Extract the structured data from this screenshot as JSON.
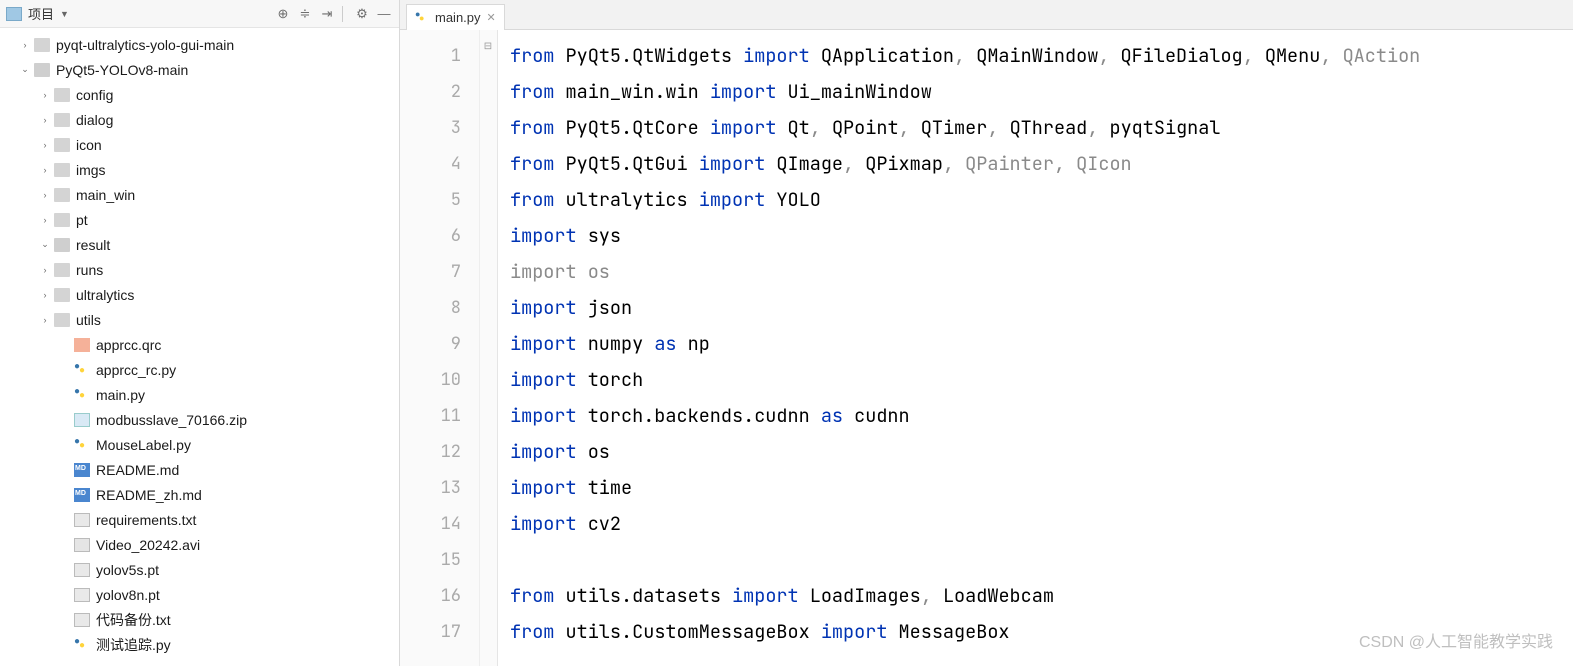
{
  "sidebar": {
    "title": "项目",
    "tree": [
      {
        "depth": 0,
        "chev": "right",
        "icon": "folder",
        "label": "pyqt-ultralytics-yolo-gui-main"
      },
      {
        "depth": 0,
        "chev": "down",
        "icon": "folder open",
        "label": "PyQt5-YOLOv8-main"
      },
      {
        "depth": 1,
        "chev": "right",
        "icon": "folder",
        "label": "config"
      },
      {
        "depth": 1,
        "chev": "right",
        "icon": "folder",
        "label": "dialog"
      },
      {
        "depth": 1,
        "chev": "right",
        "icon": "folder",
        "label": "icon"
      },
      {
        "depth": 1,
        "chev": "right",
        "icon": "folder",
        "label": "imgs"
      },
      {
        "depth": 1,
        "chev": "right",
        "icon": "folder",
        "label": "main_win"
      },
      {
        "depth": 1,
        "chev": "right",
        "icon": "folder",
        "label": "pt"
      },
      {
        "depth": 1,
        "chev": "down",
        "icon": "folder open",
        "label": "result"
      },
      {
        "depth": 1,
        "chev": "right",
        "icon": "folder",
        "label": "runs"
      },
      {
        "depth": 1,
        "chev": "right",
        "icon": "folder",
        "label": "ultralytics"
      },
      {
        "depth": 1,
        "chev": "right",
        "icon": "folder",
        "label": "utils"
      },
      {
        "depth": 2,
        "chev": "",
        "icon": "qrc",
        "label": "apprcc.qrc"
      },
      {
        "depth": 2,
        "chev": "",
        "icon": "py",
        "label": "apprcc_rc.py"
      },
      {
        "depth": 2,
        "chev": "",
        "icon": "py",
        "label": "main.py"
      },
      {
        "depth": 2,
        "chev": "",
        "icon": "zip",
        "label": "modbusslave_70166.zip"
      },
      {
        "depth": 2,
        "chev": "",
        "icon": "py",
        "label": "MouseLabel.py"
      },
      {
        "depth": 2,
        "chev": "",
        "icon": "md",
        "label": "README.md"
      },
      {
        "depth": 2,
        "chev": "",
        "icon": "md",
        "label": "README_zh.md"
      },
      {
        "depth": 2,
        "chev": "",
        "icon": "txt",
        "label": "requirements.txt"
      },
      {
        "depth": 2,
        "chev": "",
        "icon": "avi",
        "label": "Video_20242.avi"
      },
      {
        "depth": 2,
        "chev": "",
        "icon": "pt",
        "label": "yolov5s.pt"
      },
      {
        "depth": 2,
        "chev": "",
        "icon": "pt",
        "label": "yolov8n.pt"
      },
      {
        "depth": 2,
        "chev": "",
        "icon": "txt",
        "label": "代码备份.txt"
      },
      {
        "depth": 2,
        "chev": "",
        "icon": "py",
        "label": "测试追踪.py"
      }
    ]
  },
  "tab": {
    "label": "main.py"
  },
  "code": {
    "lines": [
      {
        "n": 1,
        "tokens": [
          {
            "t": "from ",
            "c": "kw"
          },
          {
            "t": "PyQt5.QtWidgets ",
            "c": "nm"
          },
          {
            "t": "import ",
            "c": "kw"
          },
          {
            "t": "QApplication",
            "c": "nm"
          },
          {
            "t": ", ",
            "c": "gray"
          },
          {
            "t": "QMainWindow",
            "c": "nm"
          },
          {
            "t": ", ",
            "c": "gray"
          },
          {
            "t": "QFileDialog",
            "c": "nm"
          },
          {
            "t": ", ",
            "c": "gray"
          },
          {
            "t": "QMenu",
            "c": "nm"
          },
          {
            "t": ", ",
            "c": "gray"
          },
          {
            "t": "QAction",
            "c": "gray"
          }
        ]
      },
      {
        "n": 2,
        "tokens": [
          {
            "t": "from ",
            "c": "kw"
          },
          {
            "t": "main_win.win ",
            "c": "nm"
          },
          {
            "t": "import ",
            "c": "kw"
          },
          {
            "t": "Ui_mainWindow",
            "c": "nm"
          }
        ]
      },
      {
        "n": 3,
        "tokens": [
          {
            "t": "from ",
            "c": "kw"
          },
          {
            "t": "PyQt5.QtCore ",
            "c": "nm"
          },
          {
            "t": "import ",
            "c": "kw"
          },
          {
            "t": "Qt",
            "c": "nm"
          },
          {
            "t": ", ",
            "c": "gray"
          },
          {
            "t": "QPoint",
            "c": "nm"
          },
          {
            "t": ", ",
            "c": "gray"
          },
          {
            "t": "QTimer",
            "c": "nm"
          },
          {
            "t": ", ",
            "c": "gray"
          },
          {
            "t": "QThread",
            "c": "nm"
          },
          {
            "t": ", ",
            "c": "gray"
          },
          {
            "t": "pyqtSignal",
            "c": "nm"
          }
        ]
      },
      {
        "n": 4,
        "tokens": [
          {
            "t": "from ",
            "c": "kw"
          },
          {
            "t": "PyQt5.QtGui ",
            "c": "nm"
          },
          {
            "t": "import ",
            "c": "kw"
          },
          {
            "t": "QImage",
            "c": "nm"
          },
          {
            "t": ", ",
            "c": "gray"
          },
          {
            "t": "QPixmap",
            "c": "nm"
          },
          {
            "t": ", ",
            "c": "gray"
          },
          {
            "t": "QPainter",
            "c": "gray"
          },
          {
            "t": ", ",
            "c": "gray"
          },
          {
            "t": "QIcon",
            "c": "gray"
          }
        ]
      },
      {
        "n": 5,
        "tokens": [
          {
            "t": "from ",
            "c": "kw"
          },
          {
            "t": "ultralytics ",
            "c": "nm"
          },
          {
            "t": "import ",
            "c": "kw"
          },
          {
            "t": "YOLO",
            "c": "nm"
          }
        ]
      },
      {
        "n": 6,
        "tokens": [
          {
            "t": "import ",
            "c": "kw"
          },
          {
            "t": "sys",
            "c": "nm"
          }
        ]
      },
      {
        "n": 7,
        "tokens": [
          {
            "t": "import ",
            "c": "gray"
          },
          {
            "t": "os",
            "c": "gray"
          }
        ]
      },
      {
        "n": 8,
        "tokens": [
          {
            "t": "import ",
            "c": "kw"
          },
          {
            "t": "json",
            "c": "nm"
          }
        ]
      },
      {
        "n": 9,
        "tokens": [
          {
            "t": "import ",
            "c": "kw"
          },
          {
            "t": "numpy ",
            "c": "nm"
          },
          {
            "t": "as ",
            "c": "kw"
          },
          {
            "t": "np",
            "c": "nm"
          }
        ]
      },
      {
        "n": 10,
        "tokens": [
          {
            "t": "import ",
            "c": "kw"
          },
          {
            "t": "torch",
            "c": "nm"
          }
        ]
      },
      {
        "n": 11,
        "tokens": [
          {
            "t": "import ",
            "c": "kw"
          },
          {
            "t": "torch.backends.cudnn ",
            "c": "nm"
          },
          {
            "t": "as ",
            "c": "kw"
          },
          {
            "t": "cudnn",
            "c": "nm"
          }
        ]
      },
      {
        "n": 12,
        "tokens": [
          {
            "t": "import ",
            "c": "kw"
          },
          {
            "t": "os",
            "c": "nm"
          }
        ]
      },
      {
        "n": 13,
        "tokens": [
          {
            "t": "import ",
            "c": "kw"
          },
          {
            "t": "time",
            "c": "nm"
          }
        ]
      },
      {
        "n": 14,
        "tokens": [
          {
            "t": "import ",
            "c": "kw"
          },
          {
            "t": "cv2",
            "c": "nm"
          }
        ]
      },
      {
        "n": 15,
        "tokens": []
      },
      {
        "n": 16,
        "tokens": [
          {
            "t": "from ",
            "c": "kw"
          },
          {
            "t": "utils.datasets ",
            "c": "nm"
          },
          {
            "t": "import ",
            "c": "kw"
          },
          {
            "t": "LoadImages",
            "c": "nm"
          },
          {
            "t": ", ",
            "c": "gray"
          },
          {
            "t": "LoadWebcam",
            "c": "nm"
          }
        ]
      },
      {
        "n": 17,
        "tokens": [
          {
            "t": "from ",
            "c": "kw"
          },
          {
            "t": "utils.CustomMessageBox ",
            "c": "nm"
          },
          {
            "t": "import ",
            "c": "kw"
          },
          {
            "t": "MessageBox",
            "c": "nm"
          }
        ]
      }
    ]
  },
  "watermark": "CSDN @人工智能教学实践"
}
